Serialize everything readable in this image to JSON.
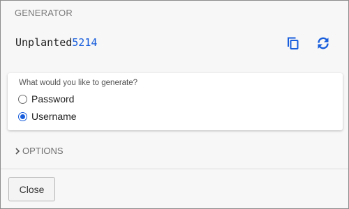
{
  "generator": {
    "section_title": "GENERATOR",
    "generated_text_letters": "Unplanted",
    "generated_text_digits": "5214",
    "copy_icon": "copy-icon",
    "regenerate_icon": "regenerate-icon"
  },
  "type_card": {
    "label": "What would you like to generate?",
    "options": [
      {
        "label": "Password",
        "selected": false
      },
      {
        "label": "Username",
        "selected": true
      }
    ]
  },
  "options_section": {
    "label": "OPTIONS",
    "icon": "chevron-right-icon",
    "expanded": false
  },
  "footer": {
    "close_label": "Close"
  },
  "colors": {
    "accent": "#175ddc",
    "text": "#212121",
    "muted": "#7a7a7a",
    "background": "#f7f7f7"
  }
}
